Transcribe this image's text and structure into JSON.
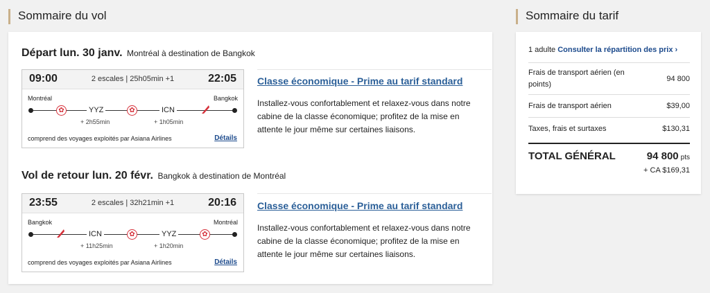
{
  "headings": {
    "flight_summary": "Sommaire du vol",
    "fare_summary": "Sommaire du tarif"
  },
  "outbound": {
    "title": "Départ lun. 30 janv.",
    "route": "Montréal à destination de Bangkok",
    "depart_time": "09:00",
    "arrive_time": "22:05",
    "summary": "2 escales | 25h05min +1",
    "origin_city": "Montréal",
    "destination_city": "Bangkok",
    "stops": [
      {
        "code": "YYZ",
        "layover": "+ 2h55min"
      },
      {
        "code": "ICN",
        "layover": "+ 1h05min"
      }
    ],
    "operated_by": "comprend des voyages exploités par Asiana Airlines",
    "details_label": "Détails",
    "cabin_label": "Classe économique - Prime au tarif standard",
    "cabin_description": "Installez-vous confortablement et relaxez-vous dans notre cabine de la classe économique; profitez de la mise en attente le jour même sur certaines liaisons."
  },
  "return": {
    "title": "Vol de retour lun. 20 févr.",
    "route": "Bangkok à destination de Montréal",
    "depart_time": "23:55",
    "arrive_time": "20:16",
    "summary": "2 escales | 32h21min +1",
    "origin_city": "Bangkok",
    "destination_city": "Montréal",
    "stops": [
      {
        "code": "ICN",
        "layover": "+ 11h25min"
      },
      {
        "code": "YYZ",
        "layover": "+ 1h20min"
      }
    ],
    "operated_by": "comprend des voyages exploités par Asiana Airlines",
    "details_label": "Détails",
    "cabin_label": "Classe économique - Prime au tarif standard",
    "cabin_description": "Installez-vous confortablement et relaxez-vous dans notre cabine de la classe économique; profitez de la mise en attente le jour même sur certaines liaisons."
  },
  "fare": {
    "passengers": "1 adulte",
    "breakdown_link": "Consulter la répartition des prix",
    "lines": [
      {
        "label": "Frais de transport aérien (en points)",
        "value": "94 800"
      },
      {
        "label": "Frais de transport aérien",
        "value": "$39,00"
      },
      {
        "label": "Taxes, frais et surtaxes",
        "value": "$130,31"
      }
    ],
    "total_label": "TOTAL GÉNÉRAL",
    "total_points": "94 800",
    "points_unit": "pts",
    "total_cash": "+ CA $169,31"
  },
  "colors": {
    "link": "#2b5f98",
    "air_canada_red": "#d6303a",
    "heading_accent": "#c9b08a"
  },
  "icons": {
    "connection": "maple-leaf-icon",
    "partner_airline": "asiana-tail-icon",
    "chevron": "chevron-right-icon"
  }
}
